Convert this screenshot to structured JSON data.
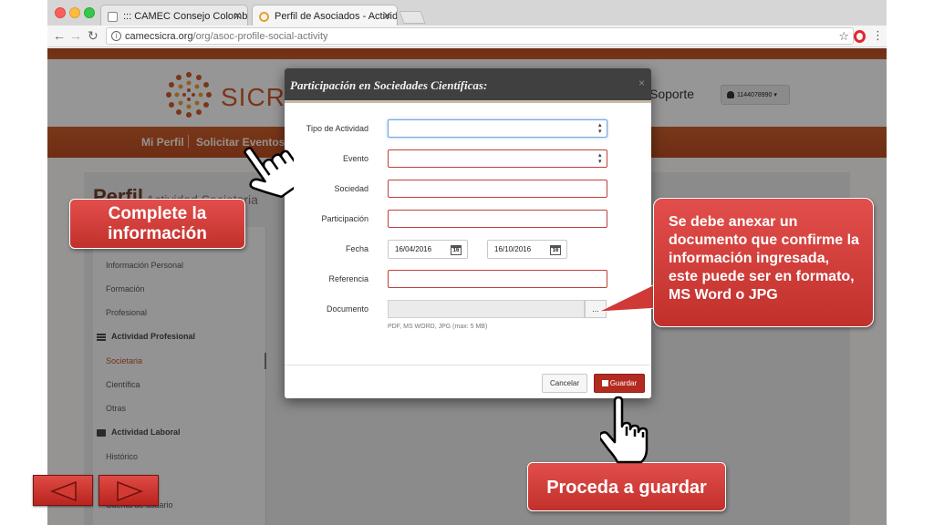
{
  "browser": {
    "tabs": [
      {
        "label": "::: CAMEC Consejo Colombian"
      },
      {
        "label": "Perfil de Asociados - Actividad"
      }
    ],
    "tab_close": "✕",
    "url_domain": "camecsicra.org",
    "url_path": "/org/asoc-profile-social-activity"
  },
  "site": {
    "logo_text": "SICRA",
    "nav": {
      "perfil": "Mi Perfil",
      "solicitar": "Solicitar Eventos"
    },
    "soporte": "Soporte",
    "user": "1144078990",
    "page_title": "Perfil",
    "page_subtitle": "Actividad Societaria"
  },
  "sidebar": {
    "items": {
      "informacion_personal": "Información Personal",
      "formacion": "Formación",
      "profesional": "Profesional",
      "actividad_profesional": "Actividad Profesional",
      "societaria": "Societaria",
      "cientifica": "Científica",
      "otras": "Otras",
      "actividad_laboral": "Actividad Laboral",
      "historico": "Histórico",
      "cuenta_usuario": "Cuenta de usuario"
    }
  },
  "modal": {
    "title": "Participación en Sociedades Científicas:",
    "close": "×",
    "labels": {
      "tipo": "Tipo de Actividad",
      "evento": "Evento",
      "sociedad": "Sociedad",
      "participacion": "Participación",
      "fecha": "Fecha",
      "referencia": "Referencia",
      "documento": "Documento"
    },
    "fecha_inicio": "16/04/2016",
    "fecha_fin": "16/10/2016",
    "calendar_day": "16",
    "doc_button": "...",
    "doc_help": "PDF, MS WORD, JPG (max: 5 MB)",
    "cancel": "Cancelar",
    "save": "Guardar"
  },
  "callouts": {
    "complete": "Complete la información",
    "anexar": "Se debe anexar un documento que confirme la información ingresada, este puede ser en formato, MS Word o JPG",
    "guardar": "Proceda a guardar"
  },
  "colors": {
    "accent": "#c4572b",
    "callout_red": "#d63f3b",
    "save_button": "#b32a20"
  }
}
